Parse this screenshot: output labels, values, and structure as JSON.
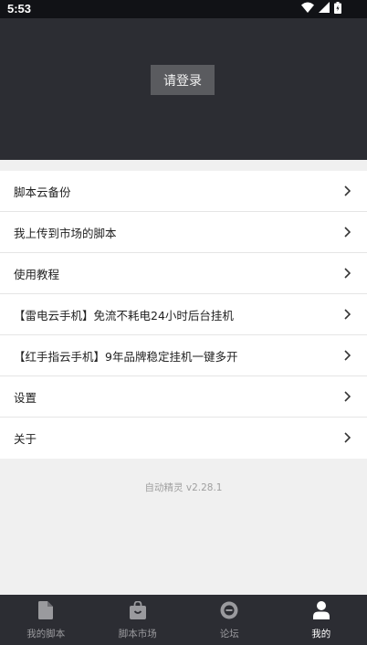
{
  "status_bar": {
    "time": "5:53",
    "icons": [
      "wifi-icon",
      "signal-icon",
      "battery-icon"
    ]
  },
  "header": {
    "login_label": "请登录"
  },
  "menu": {
    "items": [
      {
        "label": "脚本云备份"
      },
      {
        "label": "我上传到市场的脚本"
      },
      {
        "label": "使用教程"
      },
      {
        "label": "【雷电云手机】免流不耗电24小时后台挂机"
      },
      {
        "label": "【红手指云手机】9年品牌稳定挂机一键多开"
      },
      {
        "label": "设置"
      },
      {
        "label": "关于"
      }
    ]
  },
  "footer": {
    "version": "自动精灵 v2.28.1"
  },
  "tabbar": {
    "active": "我的",
    "tabs": [
      {
        "label": "我的脚本",
        "icon": "document-icon"
      },
      {
        "label": "脚本市场",
        "icon": "shopping-bag-icon"
      },
      {
        "label": "论坛",
        "icon": "forum-icon"
      },
      {
        "label": "我的",
        "icon": "person-icon"
      }
    ]
  },
  "colors": {
    "header_bg": "#2c2d33",
    "page_bg": "#f0f0f0",
    "tab_active": "#ffffff",
    "tab_inactive": "#9a9a9e"
  }
}
